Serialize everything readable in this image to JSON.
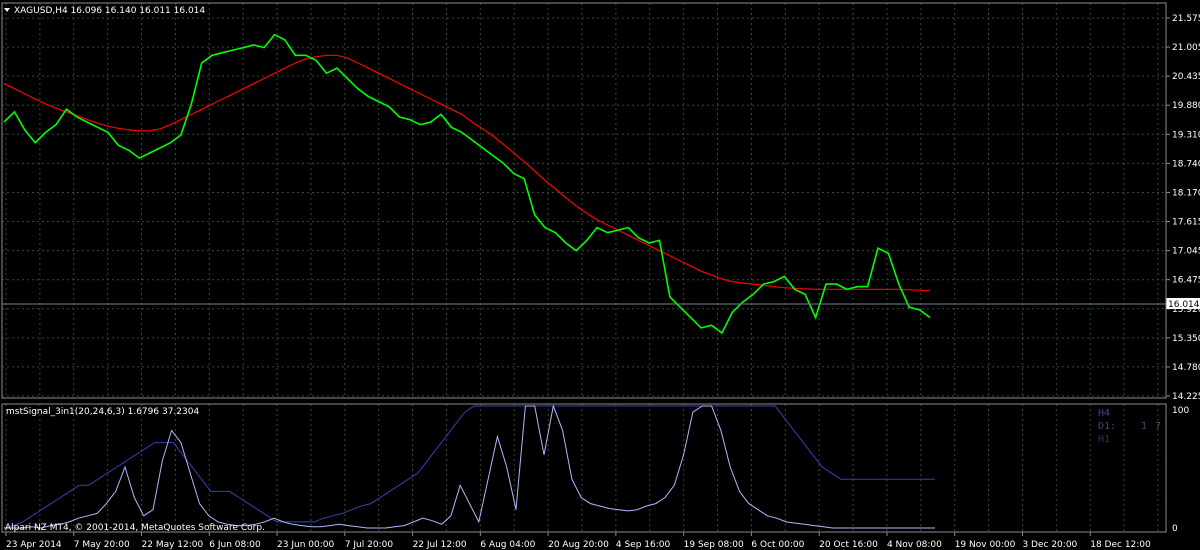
{
  "colors": {
    "background": "#000000",
    "grid": "#2f4f2f",
    "frame": "#8c8c8c",
    "price": "#00ff00",
    "ma": "#ff0000",
    "bid_line": "#708090",
    "osc_bright": "#b0b8ff",
    "osc_dark": "#3a3fb5",
    "text": "#ffffff"
  },
  "header": {
    "title_arrow_icon": "triangle-down-icon",
    "title": "XAGUSD,H4  16.096 16.140 16.011 16.014"
  },
  "chart_data": [
    {
      "type": "line",
      "symbol": "XAGUSD",
      "timeframe": "H4",
      "ohlc_label": "16.096 16.140 16.011 16.014",
      "ylim": [
        14.225,
        21.575
      ],
      "y_ticks": [
        "21.575",
        "21.005",
        "20.435",
        "19.880",
        "19.310",
        "18.740",
        "18.170",
        "17.615",
        "17.045",
        "16.475",
        "15.920",
        "15.350",
        "14.780",
        "14.225"
      ],
      "x_ticks": [
        "23 Apr 2014",
        "7 May 20:00",
        "22 May 12:00",
        "6 Jun 08:00",
        "23 Jun 00:00",
        "7 Jul 20:00",
        "22 Jul 12:00",
        "6 Aug 04:00",
        "20 Aug 20:00",
        "4 Sep 16:00",
        "19 Sep 08:00",
        "6 Oct 00:00",
        "20 Oct 16:00",
        "4 Nov 08:00",
        "19 Nov 00:00",
        "3 Dec 20:00",
        "18 Dec 12:00"
      ],
      "current_price_label": "16.014",
      "current_price": 16.014,
      "series": [
        {
          "values": [
            19.55,
            19.75,
            19.4,
            19.15,
            19.35,
            19.5,
            19.8,
            19.65,
            19.55,
            19.45,
            19.35,
            19.1,
            19.0,
            18.85,
            18.95,
            19.05,
            19.15,
            19.3,
            19.9,
            20.7,
            20.85,
            20.9,
            20.95,
            21.0,
            21.05,
            21.0,
            21.25,
            21.15,
            20.85,
            20.85,
            20.75,
            20.5,
            20.6,
            20.4,
            20.2,
            20.05,
            19.95,
            19.85,
            19.65,
            19.6,
            19.5,
            19.55,
            19.7,
            19.45,
            19.35,
            19.2,
            19.05,
            18.9,
            18.75,
            18.55,
            18.45,
            17.75,
            17.5,
            17.4,
            17.2,
            17.05,
            17.25,
            17.5,
            17.4,
            17.45,
            17.5,
            17.3,
            17.2,
            17.25,
            16.15,
            15.95,
            15.75,
            15.55,
            15.6,
            15.45,
            15.85,
            16.05,
            16.2,
            16.4,
            16.45,
            16.55,
            16.3,
            16.2,
            15.75,
            16.4,
            16.4,
            16.3,
            16.35,
            16.35,
            17.1,
            17.0,
            16.4,
            15.95,
            15.9,
            15.75
          ]
        },
        {
          "values": [
            20.3,
            20.2,
            20.1,
            20.0,
            19.9,
            19.82,
            19.75,
            19.68,
            19.6,
            19.53,
            19.47,
            19.43,
            19.4,
            19.38,
            19.38,
            19.42,
            19.5,
            19.6,
            19.7,
            19.8,
            19.9,
            20.0,
            20.1,
            20.2,
            20.3,
            20.4,
            20.5,
            20.6,
            20.7,
            20.78,
            20.82,
            20.85,
            20.85,
            20.8,
            20.7,
            20.6,
            20.5,
            20.4,
            20.3,
            20.2,
            20.1,
            20.0,
            19.9,
            19.8,
            19.7,
            19.55,
            19.42,
            19.28,
            19.12,
            18.95,
            18.78,
            18.6,
            18.42,
            18.25,
            18.08,
            17.92,
            17.78,
            17.65,
            17.55,
            17.45,
            17.35,
            17.25,
            17.15,
            17.05,
            16.95,
            16.85,
            16.75,
            16.65,
            16.58,
            16.5,
            16.45,
            16.42,
            16.4,
            16.38,
            16.35,
            16.33,
            16.32,
            16.31,
            16.3,
            16.3,
            16.3,
            16.3,
            16.3,
            16.3,
            16.3,
            16.3,
            16.3,
            16.29,
            16.28,
            16.27
          ]
        }
      ]
    },
    {
      "type": "line",
      "indicator_label": "mstSignal_3in1(20,24,6,3) 1.6796 37.2304",
      "ylim": [
        0,
        100
      ],
      "y_ticks": [
        "100",
        "0"
      ],
      "side_labels": [
        "H4",
        "D1:",
        "1",
        "7",
        "H1"
      ],
      "series": [
        {
          "values": [
            0,
            0,
            0,
            1,
            0,
            2,
            3,
            5,
            8,
            10,
            12,
            20,
            30,
            50,
            25,
            10,
            15,
            55,
            80,
            70,
            45,
            20,
            10,
            5,
            3,
            2,
            2,
            3,
            5,
            8,
            5,
            3,
            2,
            1,
            1,
            2,
            3,
            2,
            1,
            0,
            0,
            0,
            1,
            2,
            5,
            8,
            6,
            3,
            10,
            35,
            20,
            5,
            40,
            75,
            50,
            15,
            100,
            100,
            60,
            100,
            80,
            40,
            25,
            20,
            18,
            16,
            15,
            14,
            15,
            18,
            20,
            25,
            35,
            60,
            95,
            100,
            100,
            80,
            50,
            30,
            20,
            15,
            10,
            8,
            5,
            4,
            3,
            2,
            1,
            0,
            0,
            0,
            0,
            0,
            0,
            0,
            0,
            0,
            0,
            0,
            0
          ]
        },
        {
          "values": [
            0,
            2,
            5,
            10,
            15,
            20,
            25,
            30,
            35,
            35,
            40,
            45,
            50,
            55,
            60,
            65,
            70,
            70,
            70,
            60,
            50,
            40,
            30,
            30,
            30,
            25,
            20,
            15,
            10,
            5,
            5,
            5,
            5,
            5,
            8,
            10,
            12,
            15,
            18,
            20,
            25,
            30,
            35,
            40,
            45,
            55,
            65,
            75,
            85,
            95,
            100,
            100,
            100,
            100,
            100,
            100,
            100,
            100,
            100,
            100,
            100,
            100,
            100,
            100,
            100,
            100,
            100,
            100,
            100,
            100,
            100,
            100,
            100,
            100,
            100,
            100,
            100,
            100,
            100,
            100,
            100,
            100,
            100,
            90,
            80,
            70,
            60,
            50,
            45,
            40,
            40,
            40,
            40,
            40,
            40,
            40,
            40,
            40,
            40,
            40
          ]
        }
      ]
    }
  ],
  "footer_copyright": "Alpari NZ MT4, © 2001-2014, MetaQuotes Software Corp."
}
